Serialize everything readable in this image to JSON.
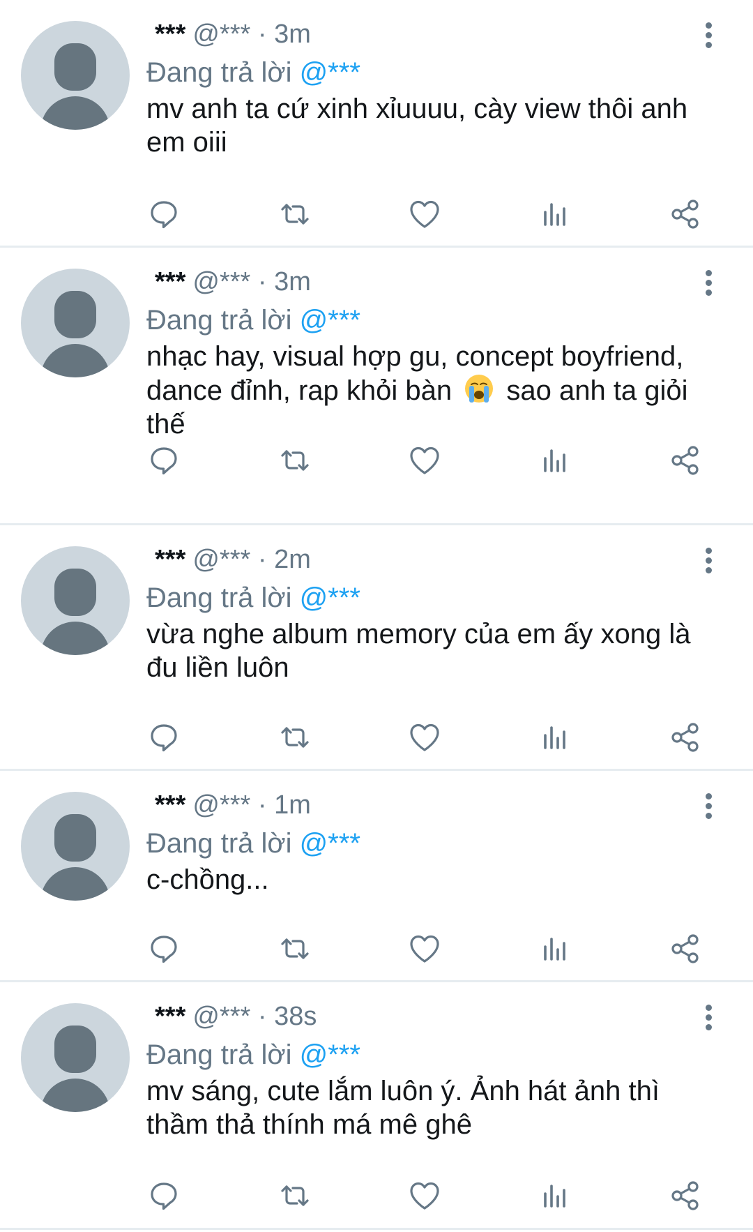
{
  "colors": {
    "text": "#14171a",
    "secondary": "#657786",
    "mention": "#1da1f2",
    "divider": "#e6ecf0",
    "avatar_bg": "#ccd6dd",
    "avatar_fg": "#66757f"
  },
  "replying_label": "Đang trả lời",
  "icons": [
    "reply-icon",
    "retweet-icon",
    "like-icon",
    "analytics-icon",
    "share-icon",
    "more-options-icon"
  ],
  "tweets": [
    {
      "name": "***",
      "handle": "@***",
      "sep": "·",
      "time": "3m",
      "reply_to": "@***",
      "text": "mv anh ta cứ xinh xỉuuuu, cày view thôi anh em oiii"
    },
    {
      "name": "***",
      "handle": "@***",
      "sep": "·",
      "time": "3m",
      "reply_to": "@***",
      "text_before": "nhạc hay, visual hợp gu, concept boyfriend, dance đỉnh, rap khỏi bàn",
      "emoji": "loudly-crying-face",
      "text_after": "sao anh ta giỏi thế"
    },
    {
      "name": "***",
      "handle": "@***",
      "sep": "·",
      "time": "2m",
      "reply_to": "@***",
      "text": "vừa nghe album memory của em ấy xong là đu liền luôn"
    },
    {
      "name": "***",
      "handle": "@***",
      "sep": "·",
      "time": "1m",
      "reply_to": "@***",
      "text": "c-chồng..."
    },
    {
      "name": "***",
      "handle": "@***",
      "sep": "·",
      "time": "38s",
      "reply_to": "@***",
      "text": "mv sáng, cute lắm luôn ý. Ảnh hát ảnh thì thầm thả thính má mê ghê"
    }
  ]
}
